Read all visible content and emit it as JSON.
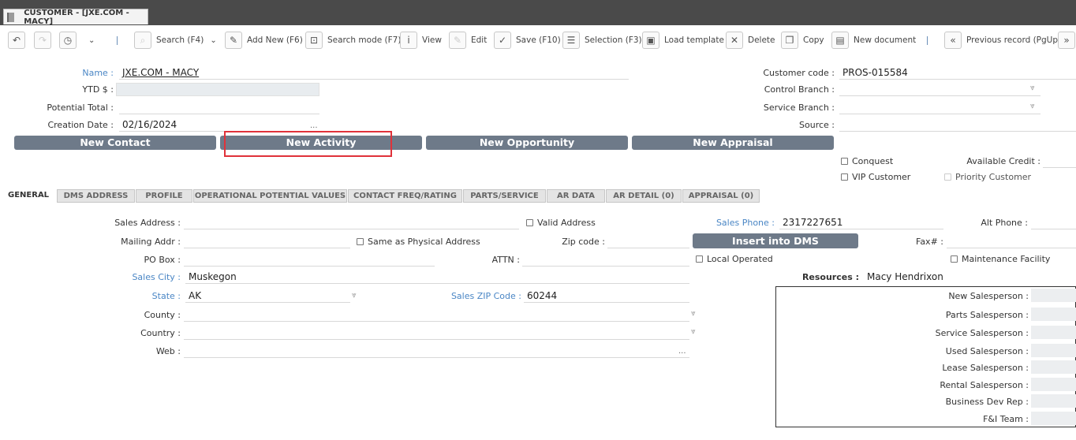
{
  "window": {
    "tab_title": "CUSTOMER - [JXE.COM - MACY]"
  },
  "toolbar": {
    "search": "Search (F4)",
    "add_new": "Add New (F6)",
    "search_mode": "Search mode (F7)",
    "view": "View",
    "edit": "Edit",
    "save": "Save (F10)",
    "selection": "Selection (F3)",
    "load_template": "Load template",
    "delete": "Delete",
    "copy": "Copy",
    "new_document": "New document",
    "previous_record": "Previous record (PgUp)"
  },
  "header": {
    "name_label": "Name :",
    "name_value": "JXE.COM - MACY",
    "ytd_label": "YTD $ :",
    "potential_label": "Potential Total :",
    "creation_label": "Creation Date :",
    "creation_value": "02/16/2024",
    "dots": "...",
    "customer_code_label": "Customer code :",
    "customer_code_value": "PROS-015584",
    "control_branch_label": "Control Branch :",
    "service_branch_label": "Service Branch :",
    "source_label": "Source :"
  },
  "actions": {
    "new_contact": "New Contact",
    "new_activity": "New Activity",
    "new_opportunity": "New Opportunity",
    "new_appraisal": "New Appraisal"
  },
  "flags": {
    "conquest": "Conquest",
    "vip": "VIP Customer",
    "available_credit": "Available Credit :",
    "priority": "Priority Customer"
  },
  "tabs": [
    "GENERAL",
    "DMS ADDRESS",
    "PROFILE",
    "OPERATIONAL POTENTIAL VALUES",
    "CONTACT FREQ/RATING",
    "PARTS/SERVICE",
    "AR DATA",
    "AR DETAIL (0)",
    "APPRAISAL (0)"
  ],
  "general": {
    "sales_address_label": "Sales Address :",
    "valid_address": "Valid Address",
    "sales_phone_label": "Sales Phone :",
    "sales_phone_value": "2317227651",
    "alt_phone_label": "Alt Phone :",
    "mailing_label": "Mailing Addr :",
    "same_as_physical": "Same as Physical Address",
    "zip_label": "Zip code :",
    "insert_dms": "Insert into DMS",
    "fax_label": "Fax# :",
    "po_box_label": "PO Box :",
    "attn_label": "ATTN :",
    "local_operated": "Local Operated",
    "maintenance_facility": "Maintenance Facility",
    "sales_city_label": "Sales City :",
    "sales_city_value": "Muskegon",
    "resources_label": "Resources :",
    "resources_value": "Macy Hendrixon",
    "state_label": "State :",
    "state_value": "AK",
    "sales_zip_label": "Sales ZIP Code :",
    "sales_zip_value": "60244",
    "county_label": "County :",
    "country_label": "Country :",
    "web_label": "Web :"
  },
  "salespersons": [
    "New Salesperson :",
    "Parts Salesperson :",
    "Service Salesperson :",
    "Used Salesperson :",
    "Lease Salesperson :",
    "Rental Salesperson :",
    "Business Dev Rep :",
    "F&I Team :"
  ],
  "colors": {
    "action_button": "#6e7a89",
    "highlight": "#e0323a",
    "link_label": "#4a86c5"
  }
}
